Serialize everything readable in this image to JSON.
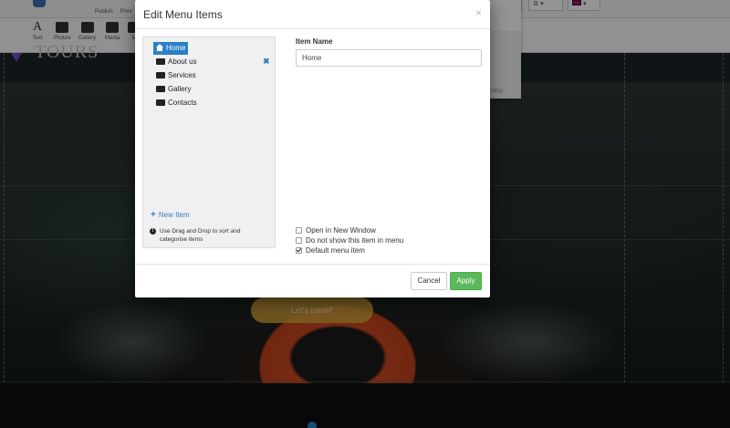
{
  "toolbar": {
    "publish_label": "Publish",
    "preview_label": "Prev",
    "tools": [
      {
        "label": "Text",
        "icon": "text-icon"
      },
      {
        "label": "Picture",
        "icon": "picture-icon"
      },
      {
        "label": "Gallery",
        "icon": "gallery-icon"
      },
      {
        "label": "Media",
        "icon": "media-icon"
      },
      {
        "label": "M",
        "icon": "map-icon"
      }
    ],
    "settings_icon": "gear-icon",
    "language_icon": "flag-uk-icon"
  },
  "site": {
    "logo_text": "TOURS",
    "cta_label": "Let's travel!",
    "side_panel_text": "anding"
  },
  "modal": {
    "title": "Edit Menu Items",
    "close_label": "×",
    "menu_items": [
      {
        "label": "Home",
        "icon": "home-icon",
        "active": true
      },
      {
        "label": "About us",
        "icon": "folder-open-icon",
        "active": false
      },
      {
        "label": "Services",
        "icon": "folder-open-icon",
        "active": false
      },
      {
        "label": "Gallery",
        "icon": "folder-open-icon",
        "active": false
      },
      {
        "label": "Contacts",
        "icon": "folder-open-icon",
        "active": false
      }
    ],
    "remove_label": "✖",
    "new_item_label": "New Item",
    "new_item_icon": "plus-icon",
    "hint_icon": "info-icon",
    "hint_text": "Use Drag and Drop to sort and categorise items",
    "item_name_label": "Item Name",
    "item_name_value": "Home",
    "options": [
      {
        "label": "Open in New Window",
        "checked": false
      },
      {
        "label": "Do not show this item in menu",
        "checked": false
      },
      {
        "label": "Default menu item",
        "checked": true
      }
    ],
    "cancel_label": "Cancel",
    "apply_label": "Apply"
  },
  "colors": {
    "accent": "#2b7fc7",
    "apply": "#5cb85c",
    "cta": "#d6a53a"
  }
}
